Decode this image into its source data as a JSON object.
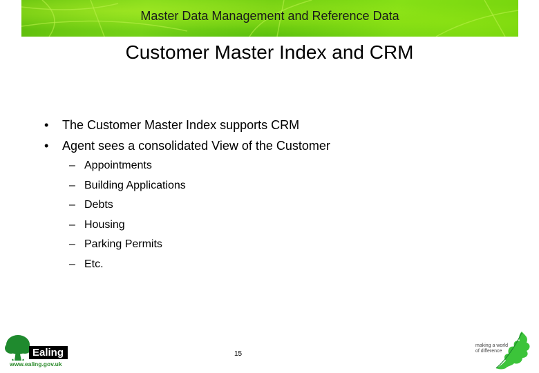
{
  "header": {
    "banner_title": "Master Data Management and Reference Data"
  },
  "slide": {
    "title": "Customer Master Index and CRM",
    "bullets": [
      "The Customer Master Index supports CRM",
      "Agent sees a consolidated View of the Customer"
    ],
    "bullet_glyph": "•",
    "sub_glyph": "–",
    "sub_items": [
      "Appointments",
      "Building Applications",
      "Debts",
      "Housing",
      "Parking Permits",
      "Etc."
    ],
    "page_number": "15"
  },
  "footer": {
    "logo_name": "Ealing",
    "logo_url_text": "www.ealing.gov.uk",
    "tagline_line1": "making a world",
    "tagline_line2": "of difference"
  },
  "colors": {
    "banner_green": "#78d60e",
    "logo_green": "#1f8a2e",
    "leaf_green": "#3cc43a"
  }
}
